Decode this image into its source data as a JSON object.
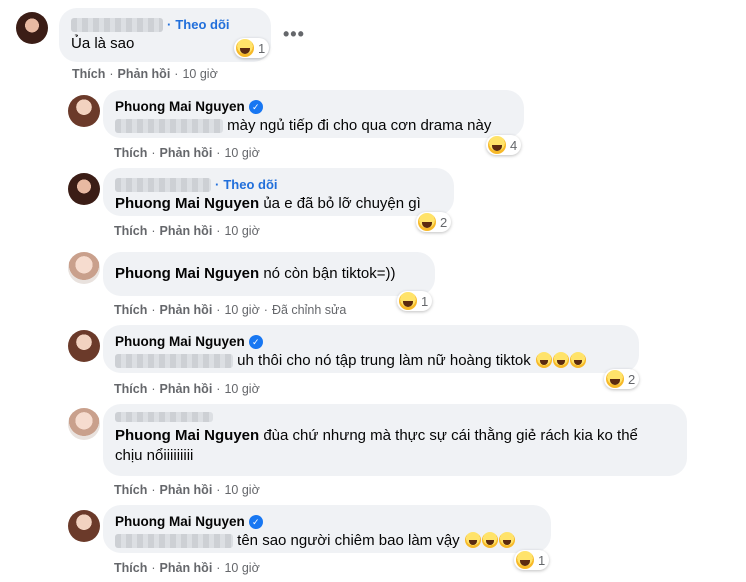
{
  "comments": [
    {
      "follow": "Theo dõi",
      "text": "Ủa là sao",
      "reaction_count": "1",
      "actions": {
        "like": "Thích",
        "reply": "Phản hồi",
        "time": "10 giờ"
      }
    },
    {
      "author": "Phuong Mai Nguyen",
      "text": "mày ngủ tiếp đi cho qua cơn drama này",
      "reaction_count": "4",
      "actions": {
        "like": "Thích",
        "reply": "Phản hồi",
        "time": "10 giờ"
      }
    },
    {
      "follow": "Theo dõi",
      "mention": "Phuong Mai Nguyen",
      "text": "ủa e đã bỏ lỡ chuyện gì",
      "reaction_count": "2",
      "actions": {
        "like": "Thích",
        "reply": "Phản hồi",
        "time": "10 giờ"
      }
    },
    {
      "mention": "Phuong Mai Nguyen",
      "text": "nó còn bận tiktok=))",
      "reaction_count": "1",
      "actions": {
        "like": "Thích",
        "reply": "Phản hồi",
        "time": "10 giờ",
        "edited": "Đã chỉnh sửa"
      }
    },
    {
      "author": "Phuong Mai Nguyen",
      "text": "uh thôi cho nó tập trung làm nữ hoàng tiktok",
      "reaction_count": "2",
      "actions": {
        "like": "Thích",
        "reply": "Phản hồi",
        "time": "10 giờ"
      }
    },
    {
      "mention": "Phuong Mai Nguyen",
      "text": "đùa chứ nhưng mà thực sự cái thằng giẻ rách kia ko thể",
      "text2": "chịu nổiiiiiiiii",
      "actions": {
        "like": "Thích",
        "reply": "Phản hồi",
        "time": "10 giờ"
      }
    },
    {
      "author": "Phuong Mai Nguyen",
      "text": "tên sao người chiêm bao làm vậy",
      "reaction_count": "1",
      "actions": {
        "like": "Thích",
        "reply": "Phản hồi",
        "time": "10 giờ"
      }
    }
  ],
  "more_label": "•••",
  "separator": "·",
  "colors": {
    "bubble": "#f0f2f5",
    "link": "#216fdb",
    "meta": "#65676b",
    "verified": "#1877f2"
  }
}
